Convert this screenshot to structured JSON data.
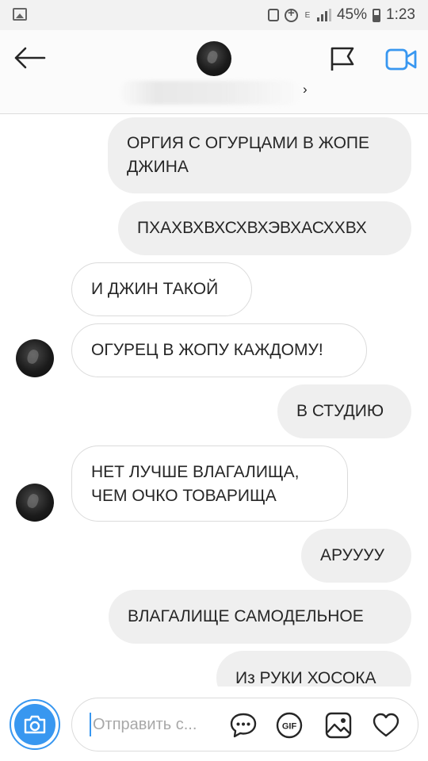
{
  "status_bar": {
    "network": "E",
    "battery": "45%",
    "time": "1:23"
  },
  "header": {
    "icons": [
      "back-arrow-icon",
      "flag-icon",
      "video-call-icon"
    ]
  },
  "messages": [
    {
      "from": "me",
      "lines": [
        "ОРГИЯ С ОГУРЦАМИ В ЖОПЕ",
        "ДЖИНА"
      ]
    },
    {
      "from": "me",
      "lines": [
        "ПХАХВХВХСХВХЭВХАСХХВХ"
      ]
    },
    {
      "from": "them",
      "lines": [
        "И ДЖИН ТАКОЙ"
      ]
    },
    {
      "from": "them",
      "lines": [
        "ОГУРЕЦ В ЖОПУ КАЖДОМУ!"
      ]
    },
    {
      "from": "me",
      "lines": [
        "В СТУДИЮ"
      ]
    },
    {
      "from": "them",
      "lines": [
        "НЕТ ЛУЧШЕ ВЛАГАЛИЩА,",
        "ЧЕМ ОЧКО ТОВАРИЩА"
      ]
    },
    {
      "from": "me",
      "lines": [
        "АРУУУУ"
      ]
    },
    {
      "from": "me",
      "lines": [
        "ВЛАГАЛИЩЕ САМОДЕЛЬНОЕ"
      ]
    },
    {
      "from": "me",
      "lines": [
        "Из РУКИ ХОСОКА"
      ]
    }
  ],
  "composer": {
    "placeholder": "Отправить с...",
    "gif_label": "GIF",
    "icons": [
      "camera-icon",
      "chat-bubble-icon",
      "gif-icon",
      "gallery-icon",
      "heart-icon"
    ],
    "accent": "#3897f0"
  }
}
